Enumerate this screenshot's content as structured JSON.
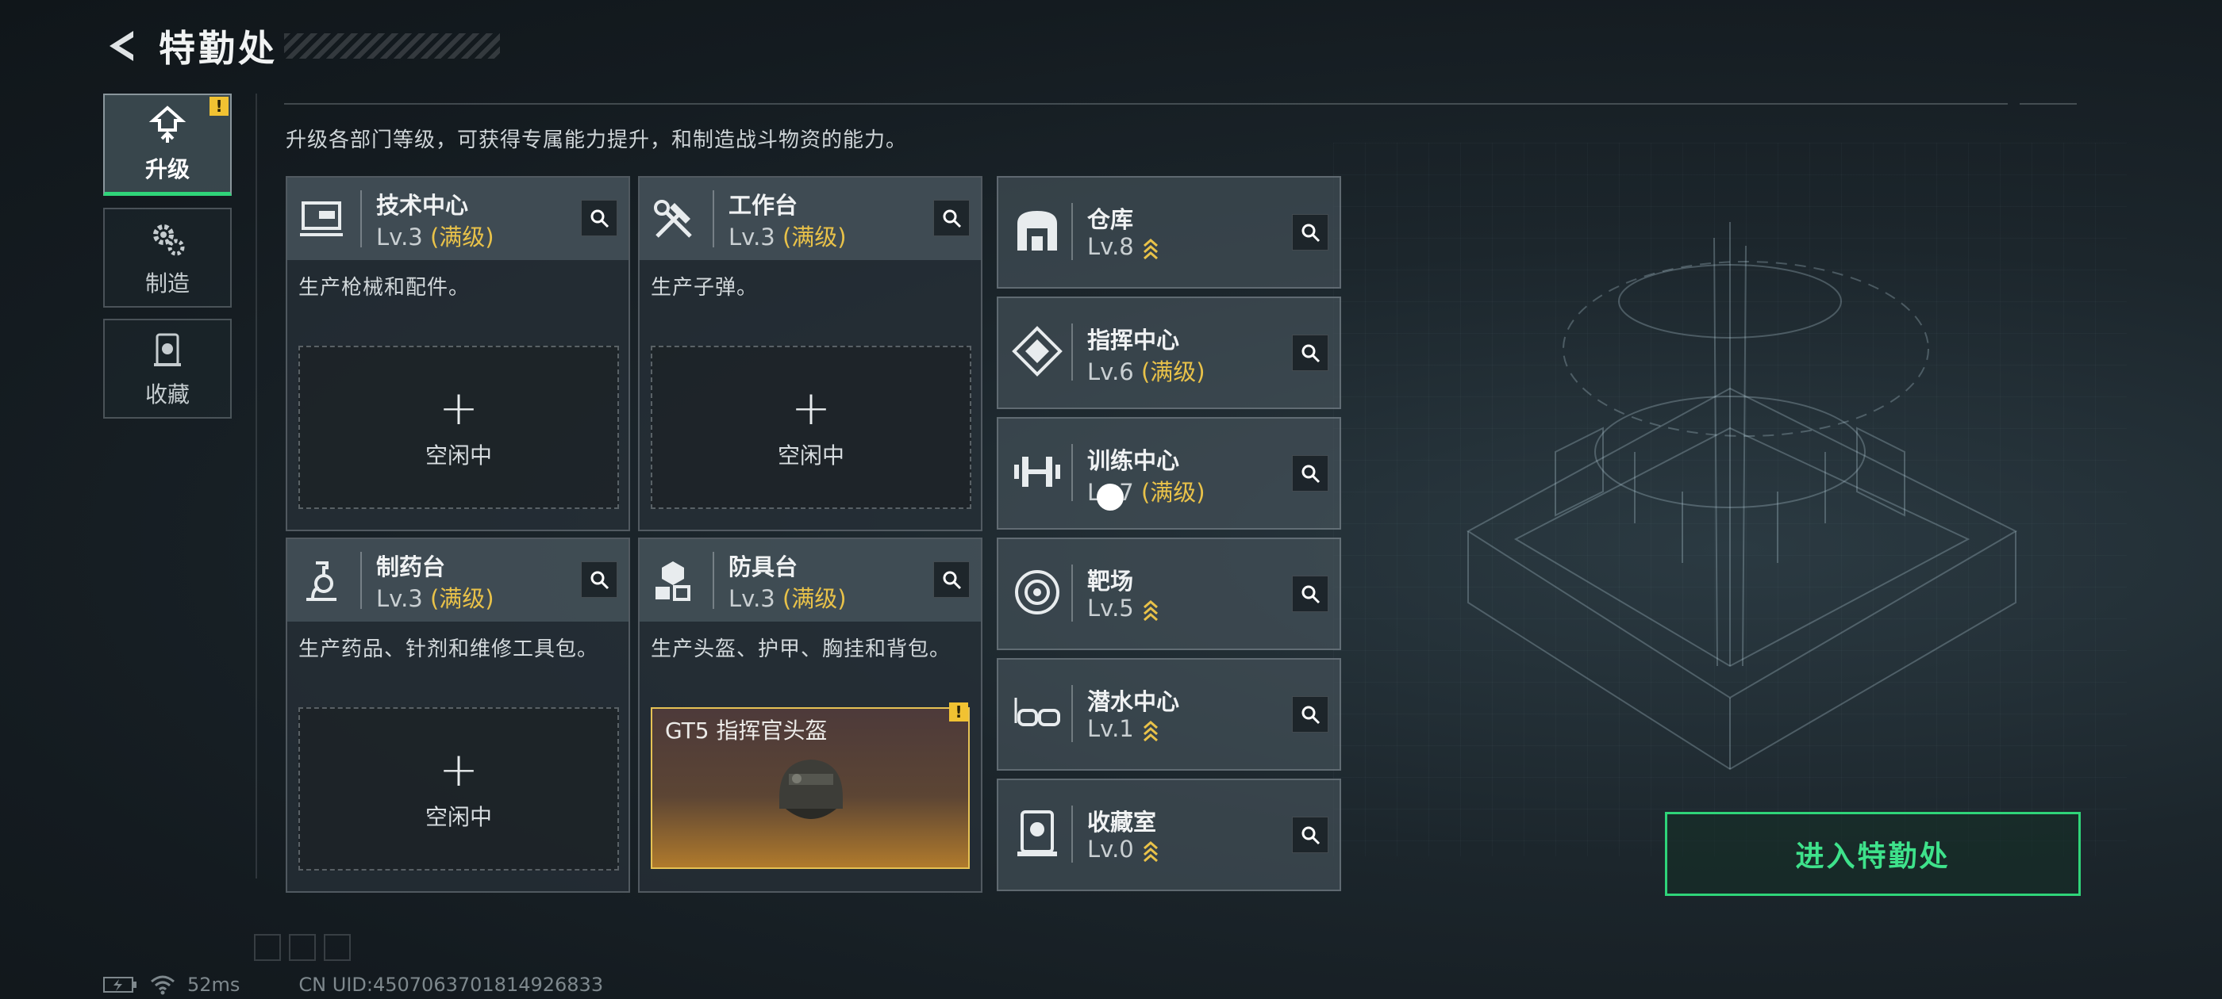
{
  "header": {
    "title": "特勤处"
  },
  "nav": [
    {
      "label": "升级",
      "icon": "upgrade-icon",
      "active": true
    },
    {
      "label": "制造",
      "icon": "gears-icon",
      "active": false
    },
    {
      "label": "收藏",
      "icon": "collection-icon",
      "active": false
    }
  ],
  "nav_alert": "!",
  "description": "升级各部门等级，可获得专属能力提升，和制造战斗物资的能力。",
  "departments": [
    {
      "name": "技术中心",
      "level": "Lv.3",
      "max": "(满级)",
      "desc": "生产枪械和配件。",
      "slot_plus": "+",
      "slot_status": "空闲中",
      "icon": "tech-center-icon"
    },
    {
      "name": "工作台",
      "level": "Lv.3",
      "max": "(满级)",
      "desc": "生产子弹。",
      "slot_plus": "+",
      "slot_status": "空闲中",
      "icon": "workbench-icon"
    },
    {
      "name": "制药台",
      "level": "Lv.3",
      "max": "(满级)",
      "desc": "生产药品、针剂和维修工具包。",
      "slot_plus": "+",
      "slot_status": "空闲中",
      "icon": "pharmacy-icon"
    },
    {
      "name": "防具台",
      "level": "Lv.3",
      "max": "(满级)",
      "desc": "生产头盔、护甲、胸挂和背包。",
      "slot_item": "GT5 指挥官头盔",
      "slot_alert": "!",
      "icon": "armor-bench-icon"
    }
  ],
  "facilities": [
    {
      "name": "仓库",
      "level": "Lv.8",
      "max": "",
      "upgradable": true,
      "icon": "warehouse-icon"
    },
    {
      "name": "指挥中心",
      "level": "Lv.6",
      "max": "(满级)",
      "upgradable": false,
      "icon": "command-center-icon"
    },
    {
      "name": "训练中心",
      "level": "Lv.7",
      "max": "(满级)",
      "upgradable": false,
      "icon": "training-center-icon"
    },
    {
      "name": "靶场",
      "level": "Lv.5",
      "max": "",
      "upgradable": true,
      "icon": "shooting-range-icon"
    },
    {
      "name": "潜水中心",
      "level": "Lv.1",
      "max": "",
      "upgradable": true,
      "icon": "diving-center-icon"
    },
    {
      "name": "收藏室",
      "level": "Lv.0",
      "max": "",
      "upgradable": true,
      "icon": "collection-room-icon"
    }
  ],
  "enter_button": "进入特勤处",
  "status": {
    "ping": "52ms",
    "uid": "CN UID:4507063701814926833"
  },
  "colors": {
    "accent_green": "#2fd479",
    "max_level_gold": "#e9c249",
    "upgrade_arrow": "#e9c249"
  }
}
